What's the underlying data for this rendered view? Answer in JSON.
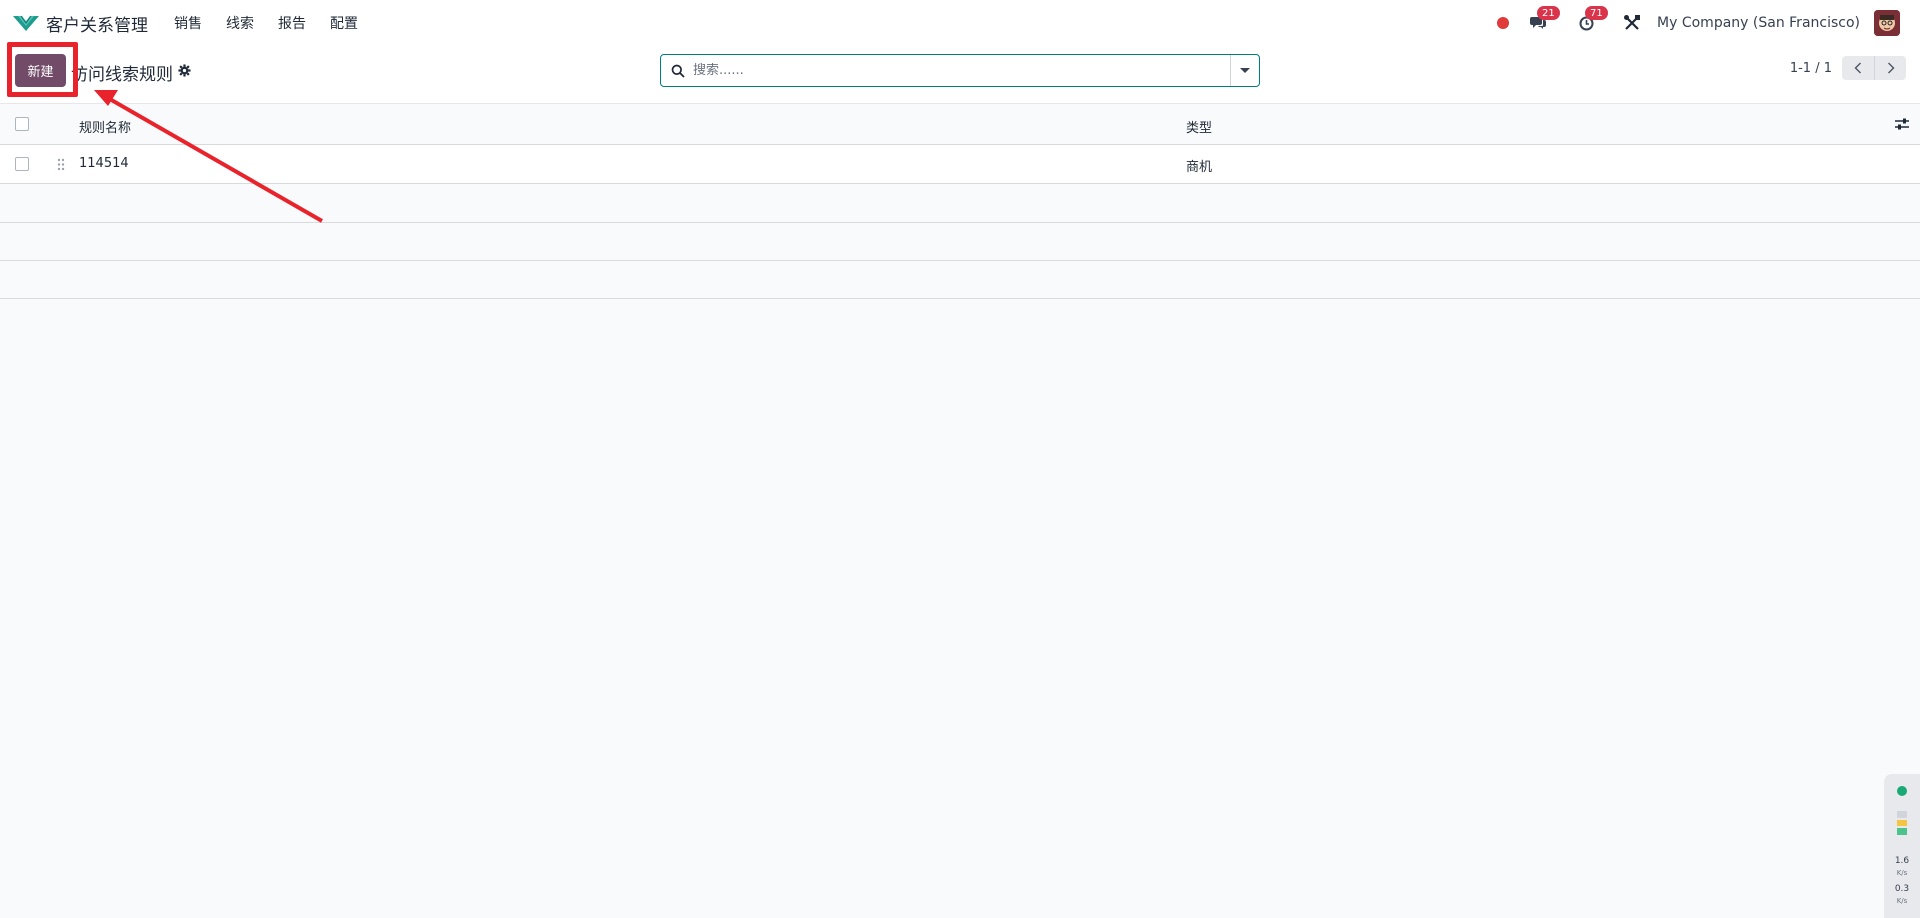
{
  "navbar": {
    "app_title": "客户关系管理",
    "menu": [
      "销售",
      "线索",
      "报告",
      "配置"
    ],
    "chat_badge": "21",
    "activity_badge": "71",
    "company": "My Company (San Francisco)"
  },
  "control": {
    "new_label": "新建",
    "title": "访问线索规则",
    "search_placeholder": "搜索......",
    "pager": "1-1 / 1"
  },
  "list": {
    "columns": [
      "规则名称",
      "类型"
    ],
    "rows": [
      {
        "name": "114514",
        "type": "商机"
      }
    ]
  },
  "network": {
    "upload": "1.6",
    "upload_unit": "K/s",
    "download": "0.3",
    "download_unit": "K/s"
  },
  "colors": {
    "brand": "#714b67",
    "annotation": "#e8232b",
    "badge": "#d9344a",
    "search_focus": "#017e84"
  }
}
